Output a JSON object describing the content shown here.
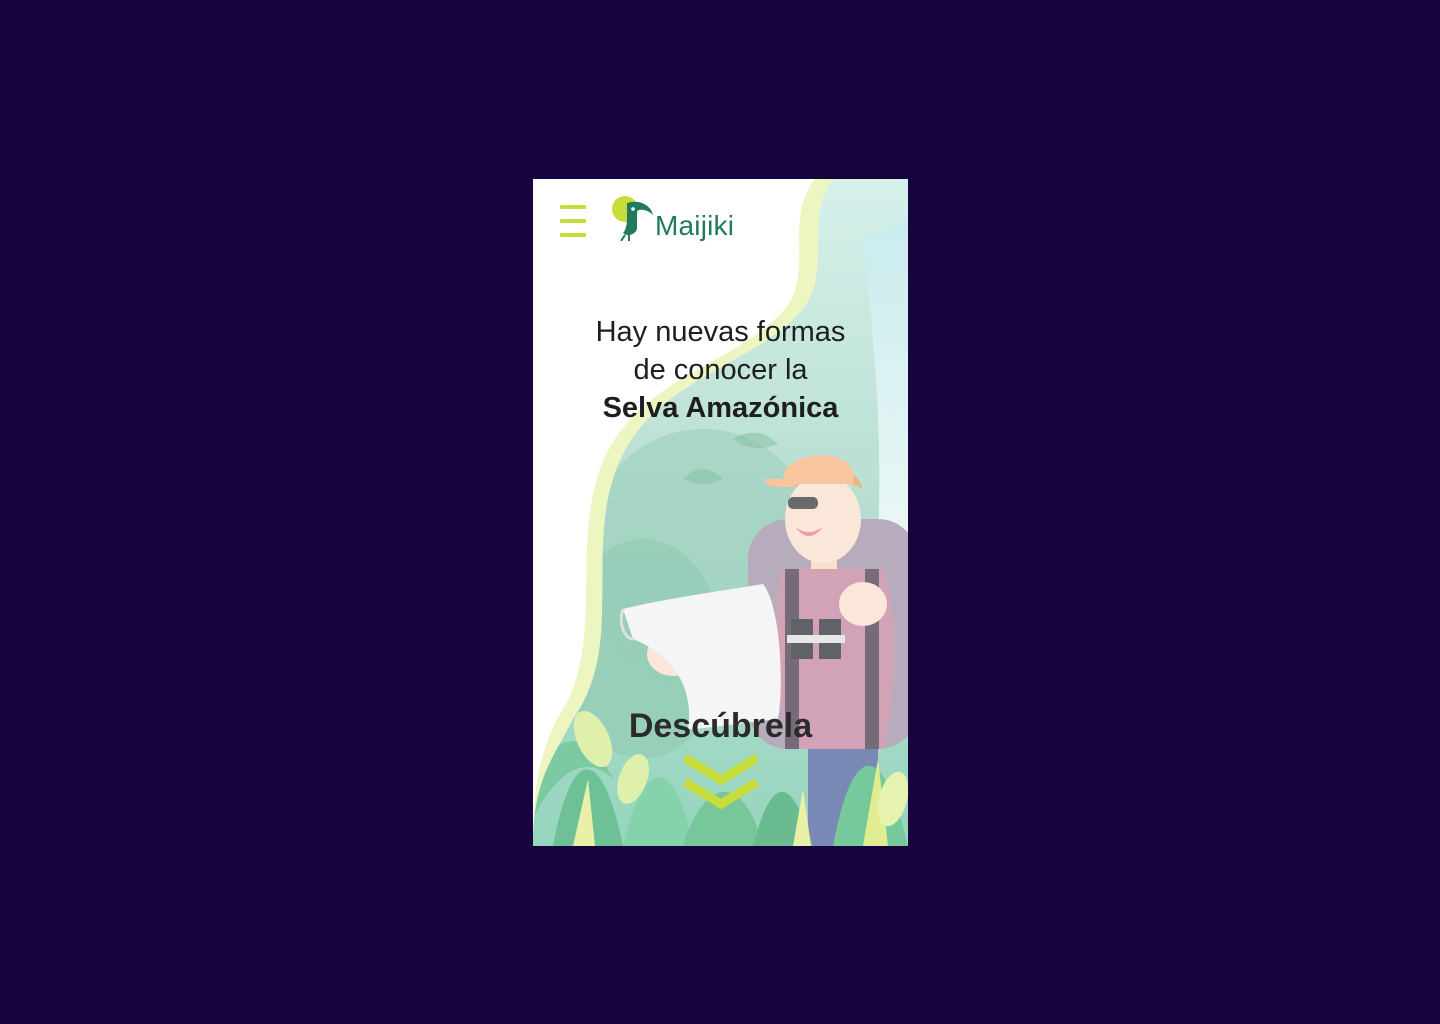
{
  "app": {
    "brand_name": "Maijiki"
  },
  "header": {
    "menu_icon": "hamburger-menu-icon",
    "logo_icon": "toucan-logo-icon"
  },
  "hero": {
    "line1": "Hay nuevas formas",
    "line2": "de conocer la",
    "line3": "Selva Amazónica"
  },
  "cta": {
    "label": "Descúbrela",
    "icon": "double-chevron-down-icon"
  },
  "colors": {
    "page_background": "#17033d",
    "accent_lime": "#c8dc3c",
    "brand_green": "#1f7a5e",
    "text_dark": "#1e1e1e"
  }
}
